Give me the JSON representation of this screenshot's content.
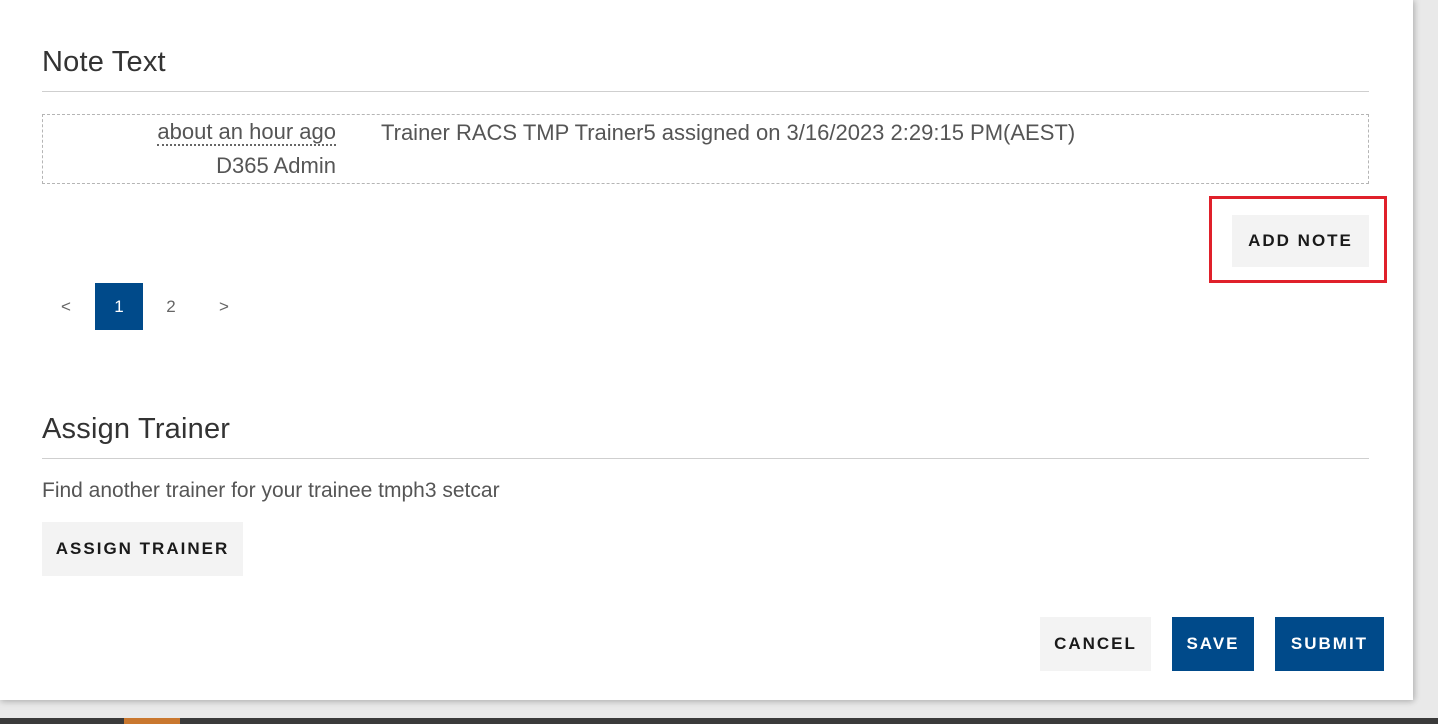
{
  "notes_section": {
    "title": "Note Text",
    "note": {
      "time": "about an hour ago",
      "author": "D365 Admin",
      "text": "Trainer RACS TMP Trainer5 assigned on 3/16/2023 2:29:15 PM(AEST)"
    },
    "add_note_label": "ADD NOTE"
  },
  "pagination": {
    "prev": "<",
    "pages": [
      "1",
      "2"
    ],
    "current": "1",
    "next": ">"
  },
  "assign_section": {
    "title": "Assign Trainer",
    "description": "Find another trainer for your trainee tmph3 setcar",
    "button_label": "ASSIGN TRAINER"
  },
  "actions": {
    "cancel": "CANCEL",
    "save": "SAVE",
    "submit": "SUBMIT"
  },
  "colors": {
    "primary": "#004a8a",
    "highlight": "#e0202a"
  }
}
